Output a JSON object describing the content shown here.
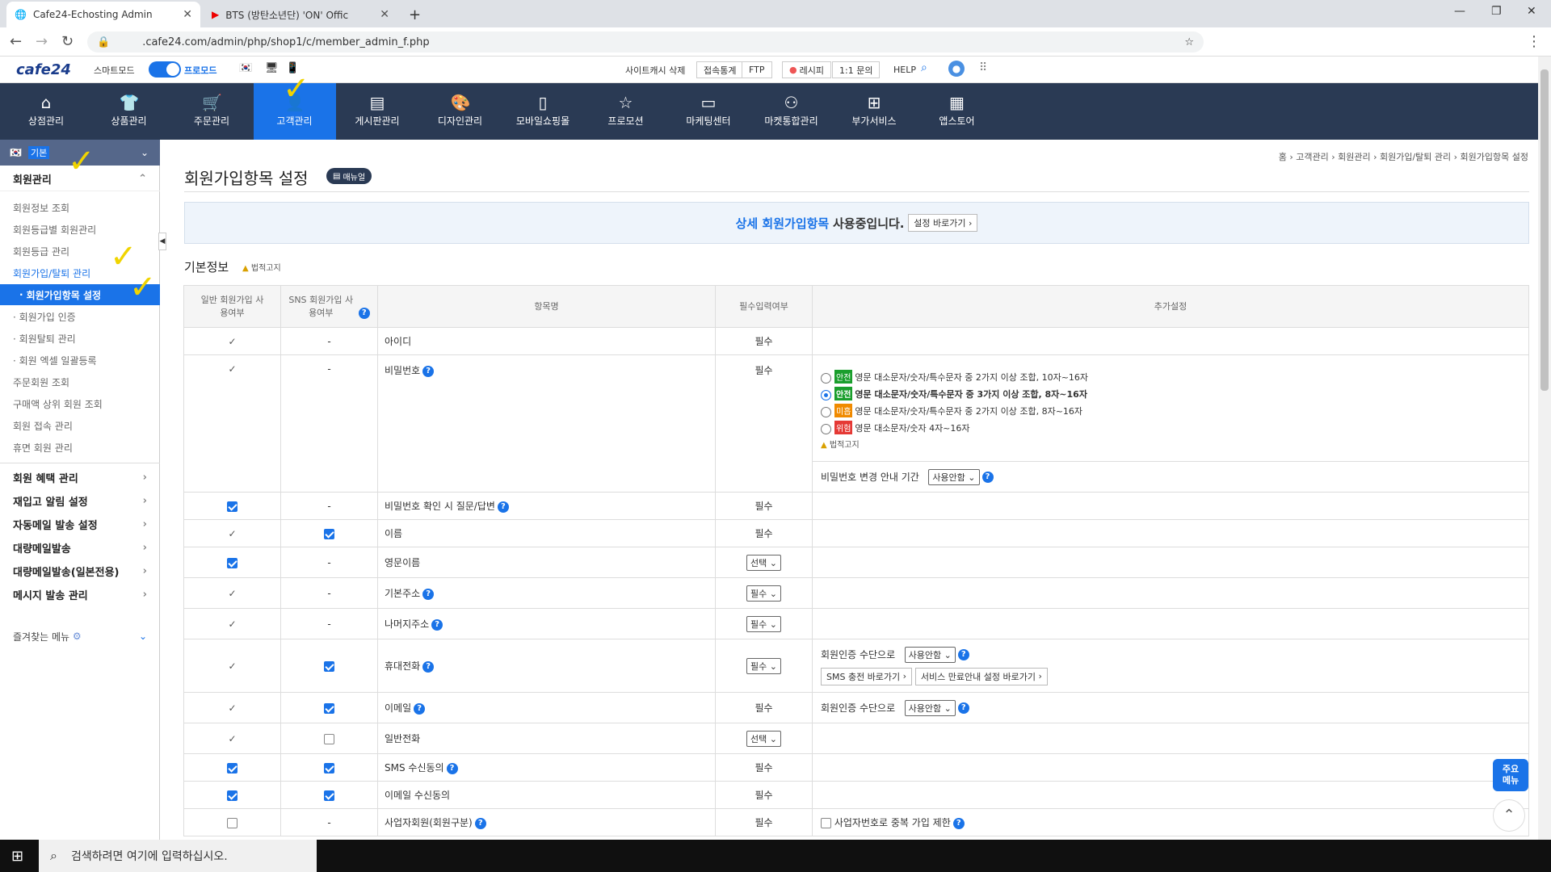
{
  "browser": {
    "tabs": [
      {
        "title": "Cafe24-Echosting Admin"
      },
      {
        "title": "BTS (방탄소년단) 'ON' Offic"
      }
    ],
    "url": ".cafe24.com/admin/php/shop1/c/member_admin_f.php"
  },
  "topstrip": {
    "logo": "cafe24",
    "smartmode": "스마트모드",
    "promode": "프로모드",
    "cache_delete": "사이트캐시 삭제",
    "stats": "접속통계",
    "ftp": "FTP",
    "recipe": "레시피",
    "inquiry": "1:1 문의",
    "help": "HELP"
  },
  "nav": [
    {
      "label": "상점관리",
      "icon": "home-icon"
    },
    {
      "label": "상품관리",
      "icon": "shirt-icon"
    },
    {
      "label": "주문관리",
      "icon": "cart-icon"
    },
    {
      "label": "고객관리",
      "icon": "user-icon"
    },
    {
      "label": "게시판관리",
      "icon": "board-icon"
    },
    {
      "label": "디자인관리",
      "icon": "palette-icon"
    },
    {
      "label": "모바일쇼핑몰",
      "icon": "mobile-icon"
    },
    {
      "label": "프로모션",
      "icon": "star-icon"
    },
    {
      "label": "마케팅센터",
      "icon": "monitor-icon"
    },
    {
      "label": "마켓통합관리",
      "icon": "network-icon"
    },
    {
      "label": "부가서비스",
      "icon": "folder-plus-icon"
    },
    {
      "label": "앱스토어",
      "icon": "grid-icon"
    }
  ],
  "sidebar": {
    "header": "기본",
    "section": "회원관리",
    "links": [
      "회원정보 조회",
      "회원등급별 회원관리",
      "회원등급 관리",
      "회원가입/탈퇴 관리"
    ],
    "selected": "회원가입항목 설정",
    "sublinks": [
      "회원가입 인증",
      "회원탈퇴 관리",
      "회원 엑셀 일괄등록"
    ],
    "links2": [
      "주문회원 조회",
      "구매액 상위 회원 조회",
      "회원 접속 관리",
      "휴면 회원 관리"
    ],
    "sections": [
      "회원 혜택 관리",
      "재입고 알림 설정",
      "자동메일 발송 설정",
      "대량메일발송",
      "대량메일발송(일본전용)",
      "메시지 발송 관리"
    ],
    "favorites": "즐겨찾는 메뉴"
  },
  "content": {
    "breadcrumb": "홈 › 고객관리 › 회원관리 › 회원가입/탈퇴 관리 › 회원가입항목 설정",
    "title": "회원가입항목 설정",
    "manual": "매뉴얼",
    "notice_a": "상세 회원가입항목",
    "notice_b": "사용중입니다.",
    "notice_btn": "설정 바로가기",
    "section": "기본정보",
    "legal": "법적고지",
    "headers": {
      "general": "일반 회원가입 사용여부",
      "sns": "SNS 회원가입 사용여부",
      "item": "항목명",
      "required": "필수입력여부",
      "extra": "추가설정"
    },
    "pw_opts": [
      {
        "badge": "안전",
        "color": "#1a9e2c",
        "text": "영문 대소문자/숫자/특수문자 중 2가지 이상 조합, 10자~16자"
      },
      {
        "badge": "안전",
        "color": "#1a9e2c",
        "text": "영문 대소문자/숫자/특수문자 중 3가지 이상 조합, 8자~16자"
      },
      {
        "badge": "미흡",
        "color": "#f08a00",
        "text": "영문 대소문자/숫자/특수문자 중 2가지 이상 조합, 8자~16자"
      },
      {
        "badge": "위험",
        "color": "#e53935",
        "text": "영문 대소문자/숫자 4자~16자"
      }
    ],
    "pw_period_label": "비밀번호 변경 안내 기간",
    "unused": "사용안함",
    "auth_label": "회원인증 수단으로",
    "sms_btn": "SMS 충전 바로가기",
    "svc_btn": "서비스 만료안내 설정 바로가기",
    "biz_label": "사업자번호로 중복 가입 제한",
    "rows": [
      {
        "name": "아이디",
        "req": "필수"
      },
      {
        "name": "비밀번호",
        "req": "필수"
      },
      {
        "name": "비밀번호 확인 시 질문/답변",
        "req": "필수"
      },
      {
        "name": "이름",
        "req": "필수"
      },
      {
        "name": "영문이름",
        "req": "선택"
      },
      {
        "name": "기본주소",
        "req": "필수"
      },
      {
        "name": "나머지주소",
        "req": "필수"
      },
      {
        "name": "휴대전화",
        "req": "필수"
      },
      {
        "name": "이메일",
        "req": "필수"
      },
      {
        "name": "일반전화",
        "req": "선택"
      },
      {
        "name": "SMS 수신동의",
        "req": "필수"
      },
      {
        "name": "이메일 수신동의",
        "req": "필수"
      },
      {
        "name": "사업자회원(회원구분)",
        "req": "필수"
      }
    ],
    "dash": "-"
  },
  "float": {
    "menu": "주요 메뉴"
  },
  "taskbar": {
    "search": "검색하려면 여기에 입력하십시오."
  }
}
